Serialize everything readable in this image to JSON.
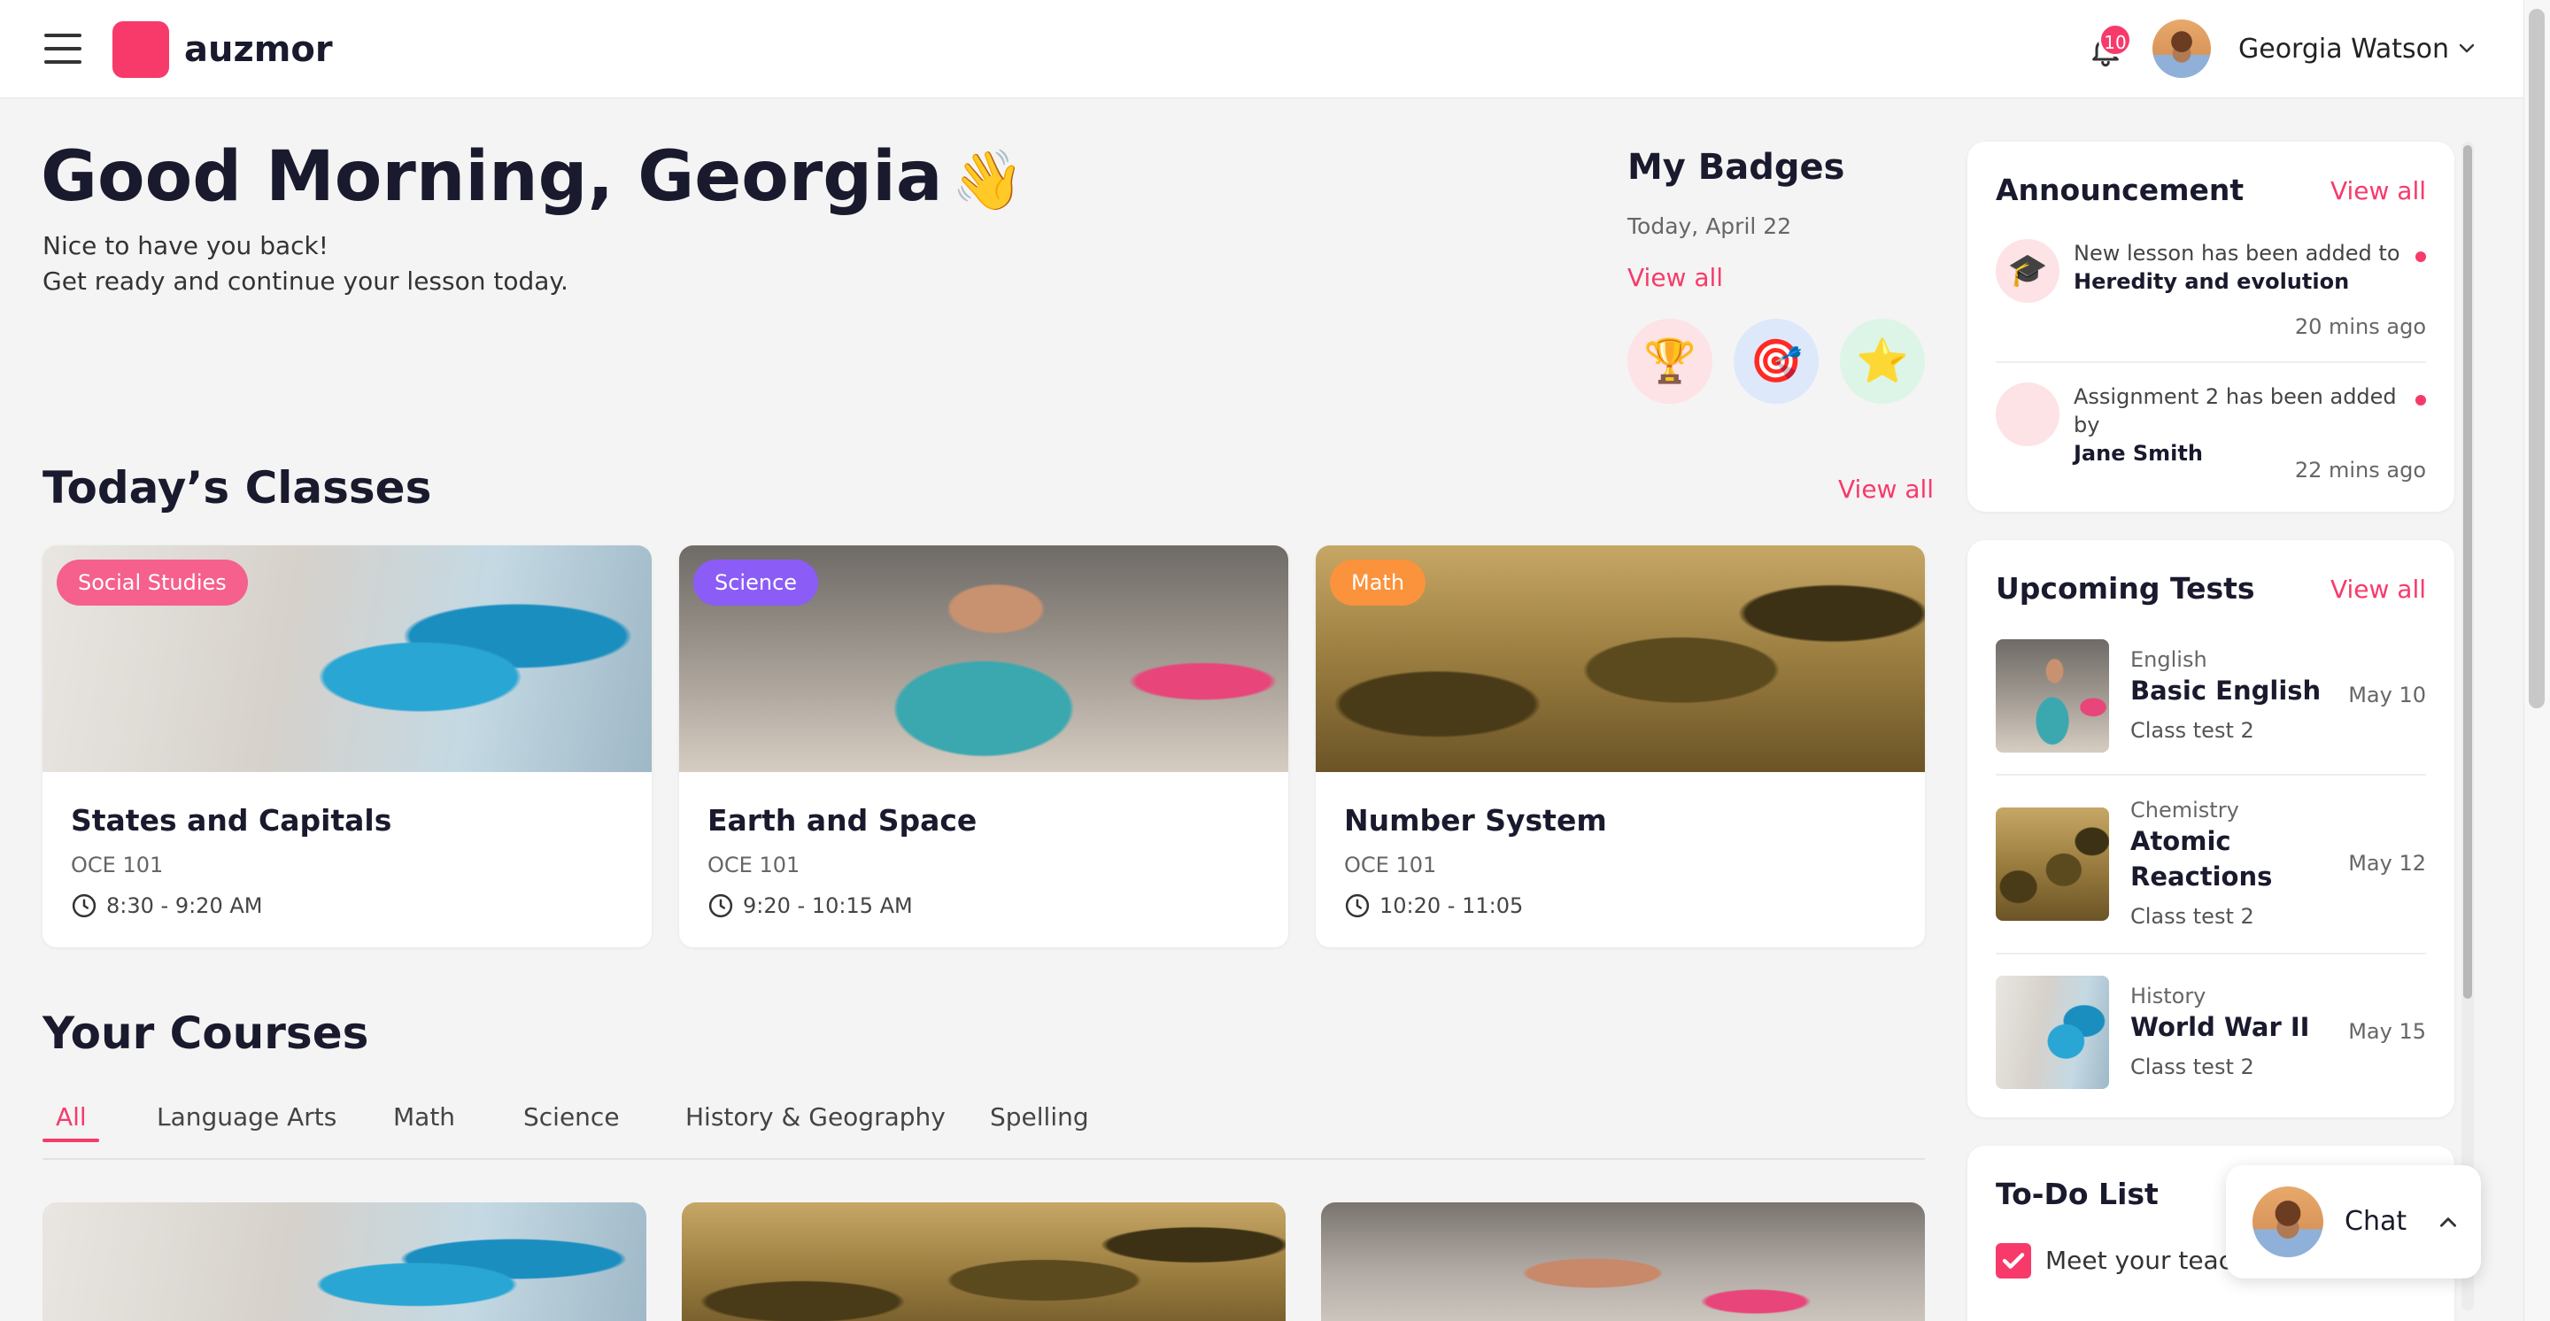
{
  "app": {
    "logo_text": "auzmor",
    "brand_color": "#f73a6a"
  },
  "header": {
    "notification_count": "10",
    "user_name": "Georgia Watson",
    "icons": [
      "menu-icon",
      "bell-icon",
      "chevron-down-icon"
    ]
  },
  "greeting": {
    "title": "Good Morning, Georgia",
    "emoji": "👋",
    "line1": "Nice to have you back!",
    "line2": "Get ready and continue your lesson today."
  },
  "badges": {
    "title": "My Badges",
    "date": "Today, April 22",
    "view_all": "View all",
    "items": [
      {
        "icon": "trophy-icon",
        "glyph": "🏆"
      },
      {
        "icon": "target-icon",
        "glyph": "🎯"
      },
      {
        "icon": "star-icon",
        "glyph": "⭐"
      }
    ]
  },
  "classes": {
    "title": "Today’s Classes",
    "view_all": "View all",
    "items": [
      {
        "tag": "Social Studies",
        "name": "States and Capitals",
        "code": "OCE 101",
        "time": "8:30 - 9:20 AM"
      },
      {
        "tag": "Science",
        "name": "Earth and Space",
        "code": "OCE 101",
        "time": "9:20 - 10:15 AM"
      },
      {
        "tag": "Math",
        "name": "Number System",
        "code": "OCE 101",
        "time": "10:20 - 11:05"
      }
    ]
  },
  "courses": {
    "title": "Your Courses",
    "tabs": [
      "All",
      "Language Arts",
      "Math",
      "Science",
      "History & Geography",
      "Spelling"
    ],
    "active_tab": "All"
  },
  "announcement": {
    "title": "Announcement",
    "view_all": "View all",
    "items": [
      {
        "text": "New lesson has been added to",
        "bold": "Heredity and evolution",
        "time": "20 mins ago",
        "icon": "graduation-cap-icon",
        "glyph": "🎓"
      },
      {
        "text": "Assignment 2 has been added by",
        "bold": "Jane Smith",
        "time": "22 mins ago",
        "icon": "avatar"
      }
    ]
  },
  "upcoming_tests": {
    "title": "Upcoming Tests",
    "view_all": "View all",
    "items": [
      {
        "subject": "English",
        "name": "Basic English",
        "class": "Class test 2",
        "date": "May 10"
      },
      {
        "subject": "Chemistry",
        "name": "Atomic Reactions",
        "class": "Class test 2",
        "date": "May 12"
      },
      {
        "subject": "History",
        "name": "World War II",
        "class": "Class test 2",
        "date": "May 15"
      }
    ]
  },
  "todo": {
    "title": "To-Do List",
    "items": [
      {
        "text": "Meet your teach",
        "checked": true
      }
    ]
  },
  "chat": {
    "label": "Chat"
  }
}
